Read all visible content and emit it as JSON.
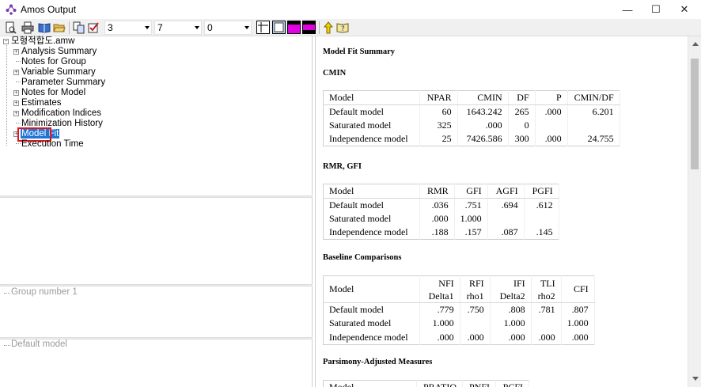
{
  "window": {
    "title": "Amos Output",
    "controls": {
      "minimize": "—",
      "maximize": "☐",
      "close": "✕"
    }
  },
  "toolbar": {
    "combo1": "3",
    "combo2": "7",
    "combo3": "0",
    "icons": [
      "print-preview-icon",
      "print-icon",
      "book-icon",
      "open-folder-icon",
      "copy-icon",
      "checklist-icon",
      "table-grid-icon",
      "frame-icon",
      "magenta-window-icon",
      "magenta-panel-icon",
      "up-arrow-icon",
      "help-book-icon"
    ]
  },
  "tree": {
    "root": "모형적합도.amw",
    "items": [
      {
        "label": "Analysis Summary",
        "expandable": true
      },
      {
        "label": "Notes for Group",
        "expandable": false
      },
      {
        "label": "Variable Summary",
        "expandable": true
      },
      {
        "label": "Parameter Summary",
        "expandable": false
      },
      {
        "label": "Notes for Model",
        "expandable": true
      },
      {
        "label": "Estimates",
        "expandable": true
      },
      {
        "label": "Modification Indices",
        "expandable": true
      },
      {
        "label": "Minimization History",
        "expandable": false
      },
      {
        "label": "Model Fit",
        "expandable": true,
        "selected": true
      },
      {
        "label": "Execution Time",
        "expandable": false
      }
    ]
  },
  "groups": {
    "group_label": "Group number 1",
    "model_label": "Default model"
  },
  "output": {
    "heading": "Model Fit Summary",
    "cmin": {
      "title": "CMIN",
      "headers": [
        "Model",
        "NPAR",
        "CMIN",
        "DF",
        "P",
        "CMIN/DF"
      ],
      "rows": [
        [
          "Default model",
          "60",
          "1643.242",
          "265",
          ".000",
          "6.201"
        ],
        [
          "Saturated model",
          "325",
          ".000",
          "0",
          "",
          ""
        ],
        [
          "Independence model",
          "25",
          "7426.586",
          "300",
          ".000",
          "24.755"
        ]
      ]
    },
    "rmr": {
      "title": "RMR, GFI",
      "headers": [
        "Model",
        "RMR",
        "GFI",
        "AGFI",
        "PGFI"
      ],
      "rows": [
        [
          "Default model",
          ".036",
          ".751",
          ".694",
          ".612"
        ],
        [
          "Saturated model",
          ".000",
          "1.000",
          "",
          ""
        ],
        [
          "Independence model",
          ".188",
          ".157",
          ".087",
          ".145"
        ]
      ]
    },
    "baseline": {
      "title": "Baseline Comparisons",
      "headers": [
        "Model",
        "NFI\nDelta1",
        "RFI\nrho1",
        "IFI\nDelta2",
        "TLI\nrho2",
        "CFI"
      ],
      "rows": [
        [
          "Default model",
          ".779",
          ".750",
          ".808",
          ".781",
          ".807"
        ],
        [
          "Saturated model",
          "1.000",
          "",
          "1.000",
          "",
          "1.000"
        ],
        [
          "Independence model",
          ".000",
          ".000",
          ".000",
          ".000",
          ".000"
        ]
      ]
    },
    "parsimony": {
      "title": "Parsimony-Adjusted Measures",
      "headers": [
        "Model",
        "PRATIO",
        "PNFI",
        "PCFI"
      ]
    }
  }
}
